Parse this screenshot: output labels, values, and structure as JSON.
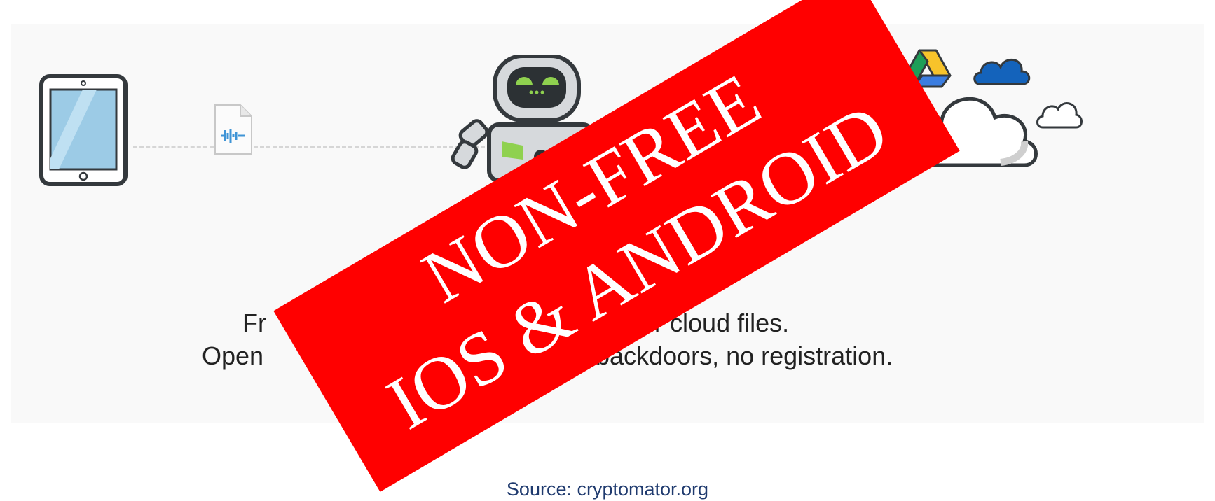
{
  "tagline": {
    "line1_left": "Fr",
    "line1_right": "r your cloud files.",
    "line2_left": "Open ",
    "line2_right": "backdoors, no registration."
  },
  "stamp": {
    "line1": "NON-FREE",
    "line2": "IOS & ANDROID",
    "color": "#ff0000"
  },
  "source": "Source: cryptomator.org",
  "icons": [
    "tablet-icon",
    "audio-file-icon",
    "robot-mascot-icon",
    "google-drive-icon",
    "onedrive-icon",
    "dropbox-icon",
    "cloud-icon",
    "cloud-outline-icon"
  ]
}
